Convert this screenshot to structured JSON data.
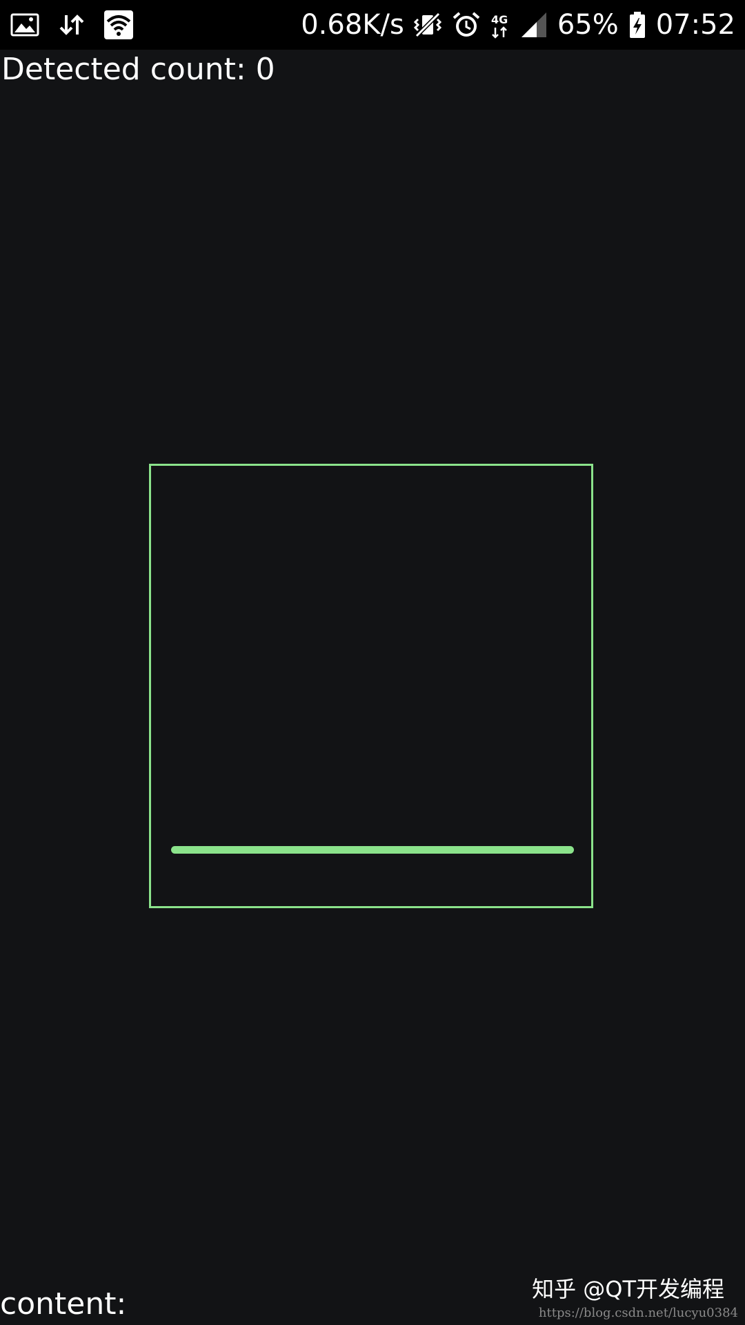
{
  "status_bar": {
    "left_icons": [
      "gallery-icon",
      "data-transfer-icon",
      "wifi-icon"
    ],
    "network_speed": "0.68K/s",
    "right_icons": [
      "mute-vibrate-icon",
      "alarm-icon",
      "4g-data-icon",
      "signal-icon",
      "battery-charging-icon"
    ],
    "network_type": "4G",
    "battery_percent": "65%",
    "time": "07:52"
  },
  "scanner": {
    "detected_count_text": "Detected count: 0",
    "content_text": "content:"
  },
  "watermarks": {
    "zhihu": "知乎 @QT开发编程",
    "url": "https://blog.csdn.net/lucyu0384"
  },
  "colors": {
    "background": "#121315",
    "status_bar": "#000000",
    "scan_frame": "#8be38b",
    "text": "#ffffff"
  }
}
